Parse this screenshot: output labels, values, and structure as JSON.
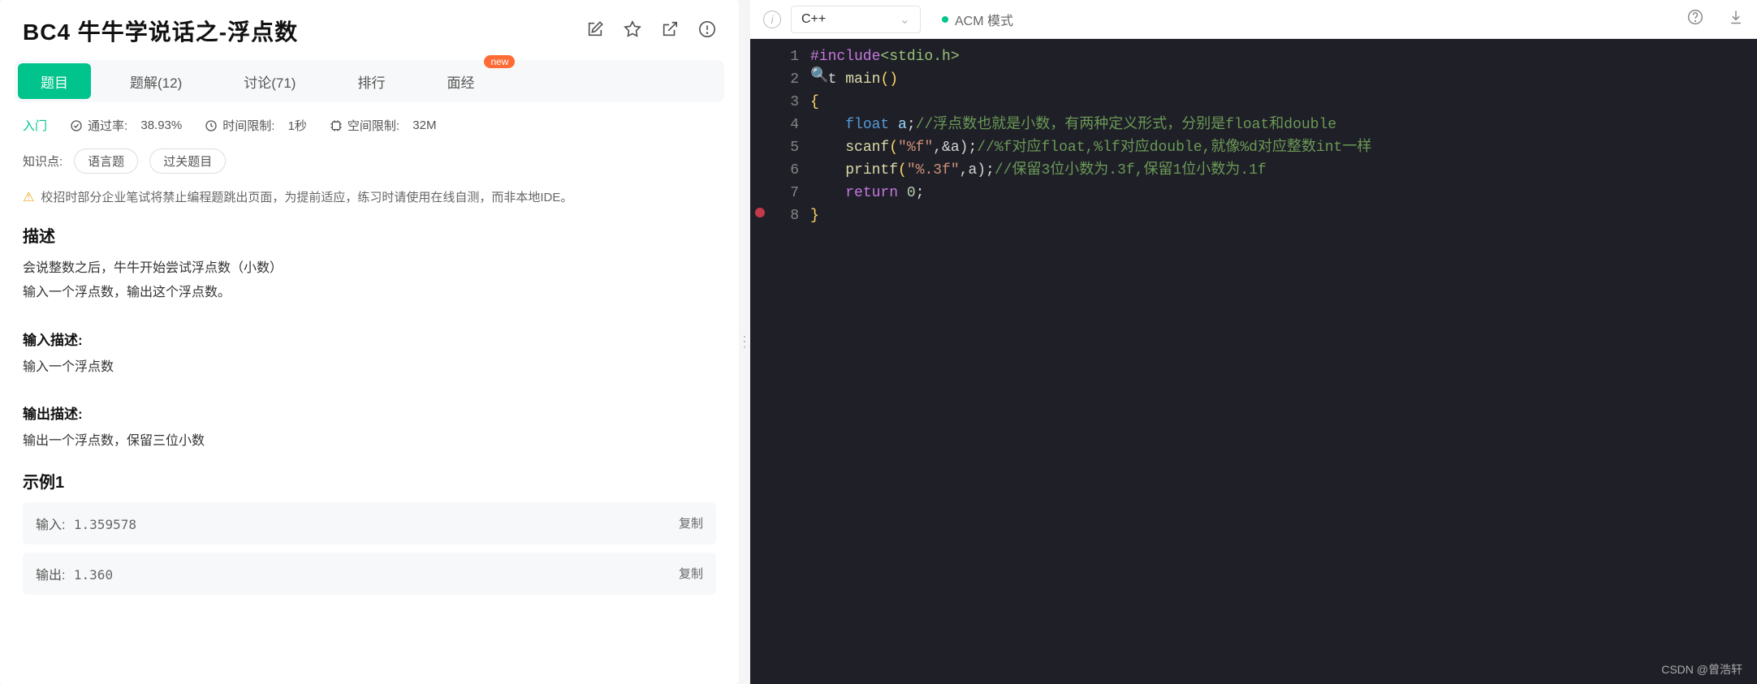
{
  "header": {
    "title": "BC4  牛牛学说话之-浮点数"
  },
  "tabs": {
    "items": [
      {
        "label": "题目",
        "active": true
      },
      {
        "label": "题解(12)"
      },
      {
        "label": "讨论(71)"
      },
      {
        "label": "排行"
      },
      {
        "label": "面经",
        "badge": "new"
      }
    ]
  },
  "meta": {
    "level": "入门",
    "pass_label": "通过率:",
    "pass_value": "38.93%",
    "time_label": "时间限制:",
    "time_value": "1秒",
    "space_label": "空间限制:",
    "space_value": "32M"
  },
  "tags": {
    "label": "知识点:",
    "items": [
      "语言题",
      "过关题目"
    ]
  },
  "warning": "校招时部分企业笔试将禁止编程题跳出页面，为提前适应，练习时请使用在线自测，而非本地IDE。",
  "desc": {
    "heading": "描述",
    "line1": "会说整数之后，牛牛开始尝试浮点数（小数）",
    "line2": "输入一个浮点数，输出这个浮点数。"
  },
  "input": {
    "heading": "输入描述:",
    "text": "输入一个浮点数"
  },
  "output": {
    "heading": "输出描述:",
    "text": "输出一个浮点数，保留三位小数"
  },
  "example": {
    "heading": "示例1",
    "in_label": "输入:",
    "in_value": "1.359578",
    "out_label": "输出:",
    "out_value": "1.360",
    "copy": "复制"
  },
  "editor": {
    "language": "C++",
    "mode": "ACM 模式",
    "code": {
      "l1_include": "#include",
      "l1_header": "<stdio.h>",
      "l2_pre": "t ",
      "l2_fn": "main",
      "l2_paren": "()",
      "l3": "{",
      "l4_indent": "    ",
      "l4_type": "float",
      "l4_var": " a",
      "l4_semi": ";",
      "l4_comment": "//浮点数也就是小数，有两种定义形式，分别是float和double",
      "l5_indent": "    ",
      "l5_fn": "scanf",
      "l5_p1": "(",
      "l5_str": "\"%f\"",
      "l5_mid": ",&a);",
      "l5_comment": "//%f对应float,%lf对应double,就像%d对应整数int一样",
      "l6_indent": "    ",
      "l6_fn": "printf",
      "l6_p1": "(",
      "l6_str": "\"%.3f\"",
      "l6_mid": ",a);",
      "l6_comment": "//保留3位小数为.3f,保留1位小数为.1f",
      "l7_indent": "    ",
      "l7_kw": "return",
      "l7_sp": " ",
      "l7_num": "0",
      "l7_semi": ";",
      "l8": "}"
    }
  },
  "watermark": "CSDN @曾浩轩"
}
